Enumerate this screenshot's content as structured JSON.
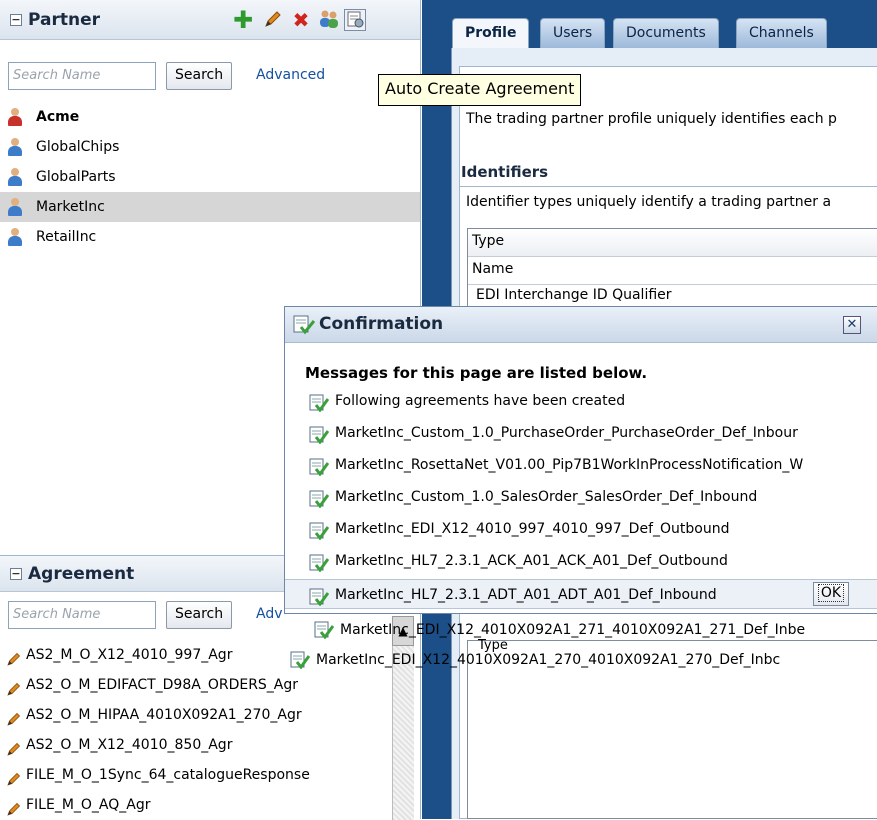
{
  "partner_panel": {
    "title": "Partner",
    "collapse_symbol": "⊟",
    "toolbar": {
      "add_icon": "plus-icon",
      "edit_icon": "pencil-icon",
      "delete_icon": "delete-x-icon",
      "users_icon": "people-icon",
      "auto_create_icon": "auto-create-agreement-icon"
    },
    "search_placeholder": "Search Name",
    "search_label": "Search",
    "advanced_label": "Advanced",
    "partners": [
      {
        "name": "Acme",
        "bold": true,
        "selected": false,
        "color": "#c7332b"
      },
      {
        "name": "GlobalChips",
        "bold": false,
        "selected": false,
        "color": "#3d7cc9"
      },
      {
        "name": "GlobalParts",
        "bold": false,
        "selected": false,
        "color": "#3d7cc9"
      },
      {
        "name": "MarketInc",
        "bold": false,
        "selected": true,
        "color": "#3d7cc9"
      },
      {
        "name": "RetailInc",
        "bold": false,
        "selected": false,
        "color": "#3d7cc9"
      }
    ]
  },
  "tooltip": "Auto Create Agreement",
  "agreement_panel": {
    "title": "Agreement",
    "collapse_symbol": "⊟",
    "search_placeholder": "Search Name",
    "search_label": "Search",
    "advanced_label_partial": "Adv",
    "agreements": [
      "AS2_M_O_X12_4010_997_Agr",
      "AS2_O_M_EDIFACT_D98A_ORDERS_Agr",
      "AS2_O_M_HIPAA_4010X092A1_270_Agr",
      "AS2_O_M_X12_4010_850_Agr",
      "FILE_M_O_1Sync_64_catalogueResponse",
      "FILE_M_O_AQ_Agr"
    ]
  },
  "tabs": [
    "Profile",
    "Users",
    "Documents",
    "Channels"
  ],
  "active_tab": "Profile",
  "profile": {
    "description": "The trading partner profile uniquely identifies each p",
    "identifiers_title": "Identifiers",
    "identifiers_description": "Identifier types uniquely identify a trading partner a",
    "table_header_type": "Type",
    "table_header_name": "Name",
    "table_first_row": "EDI Interchange ID Qualifier",
    "lower_table_header": "Type"
  },
  "dialog": {
    "title": "Confirmation",
    "heading": "Messages for this page are listed below.",
    "messages": [
      "Following agreements have been created",
      "MarketInc_Custom_1.0_PurchaseOrder_PurchaseOrder_Def_Inbour",
      "MarketInc_RosettaNet_V01.00_Pip7B1WorkInProcessNotification_W",
      "MarketInc_Custom_1.0_SalesOrder_SalesOrder_Def_Inbound",
      "MarketInc_EDI_X12_4010_997_4010_997_Def_Outbound",
      "MarketInc_HL7_2.3.1_ACK_A01_ACK_A01_Def_Outbound"
    ],
    "highlighted_message": "MarketInc_HL7_2.3.1_ADT_A01_ADT_A01_Def_Inbound",
    "ok_label": "OK",
    "overflow_messages": [
      "MarketInc_EDI_X12_4010X092A1_271_4010X092A1_271_Def_Inbe",
      "MarketInc_EDI_X12_4010X092A1_270_4010X092A1_270_Def_Inbc"
    ],
    "close_symbol": "✕"
  },
  "colors": {
    "right_background": "#1c4f88",
    "accent_blue": "#1450a0",
    "check_green": "#3aa03a",
    "pencil_orange": "#e08a1e"
  }
}
